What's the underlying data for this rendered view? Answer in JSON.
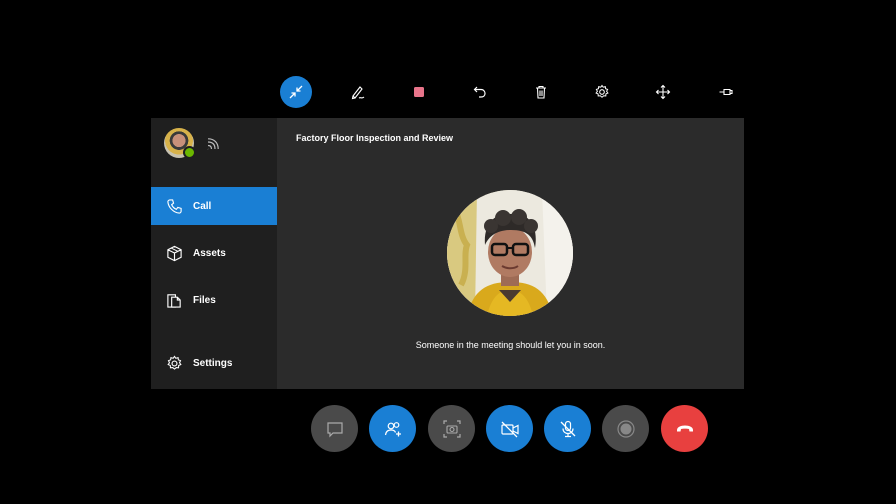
{
  "toolbar": {
    "items": [
      {
        "name": "collapse",
        "icon": "collapse-arrows-icon",
        "active": true
      },
      {
        "name": "pen",
        "icon": "pen-icon"
      },
      {
        "name": "stop",
        "icon": "stop-square-icon",
        "color": "#e8748a"
      },
      {
        "name": "undo",
        "icon": "undo-icon"
      },
      {
        "name": "delete",
        "icon": "trash-icon"
      },
      {
        "name": "settings",
        "icon": "gear-icon"
      },
      {
        "name": "move",
        "icon": "move-arrows-icon"
      },
      {
        "name": "pin",
        "icon": "pin-icon"
      }
    ]
  },
  "sidebar": {
    "presence_status_color": "#6bb700",
    "items": [
      {
        "label": "Call",
        "icon": "phone-icon",
        "active": true
      },
      {
        "label": "Assets",
        "icon": "cube-icon"
      },
      {
        "label": "Files",
        "icon": "files-icon"
      },
      {
        "label": "Settings",
        "icon": "gear-icon"
      }
    ]
  },
  "meeting": {
    "title": "Factory Floor Inspection and Review",
    "waiting_message": "Someone in the meeting should let you in soon."
  },
  "controls": [
    {
      "name": "chat",
      "icon": "chat-bubble-icon",
      "style": "gray"
    },
    {
      "name": "participants",
      "icon": "add-people-icon",
      "style": "blue"
    },
    {
      "name": "snapshot",
      "icon": "camera-snapshot-icon",
      "style": "gray"
    },
    {
      "name": "video",
      "icon": "video-off-icon",
      "style": "blue"
    },
    {
      "name": "mic",
      "icon": "mic-off-icon",
      "style": "blue"
    },
    {
      "name": "record",
      "icon": "record-icon",
      "style": "gray"
    },
    {
      "name": "hang-up",
      "icon": "hang-up-icon",
      "style": "red"
    }
  ],
  "colors": {
    "accent": "#1a7fd4",
    "hangup": "#e8403f",
    "panel": "#2b2b2b",
    "sidebar": "#1f1f1f"
  }
}
